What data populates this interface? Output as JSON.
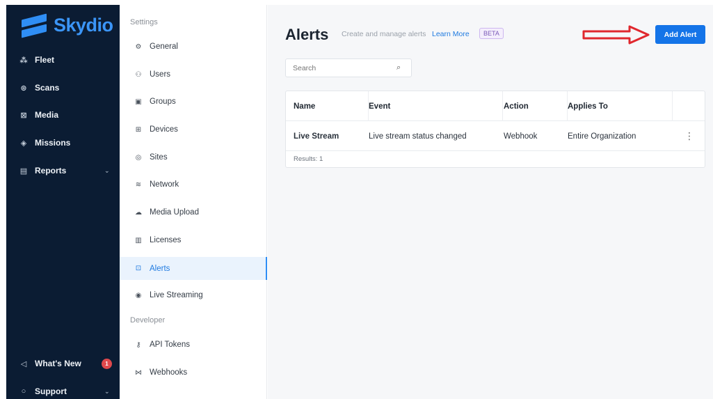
{
  "app": {
    "brand": "Skydio"
  },
  "sidebar": {
    "items": [
      {
        "label": "Fleet",
        "icon": "fleet-icon",
        "glyph": "⁂"
      },
      {
        "label": "Scans",
        "icon": "scans-icon",
        "glyph": "⊛"
      },
      {
        "label": "Media",
        "icon": "media-icon",
        "glyph": "⊠"
      },
      {
        "label": "Missions",
        "icon": "missions-icon",
        "glyph": "◈"
      },
      {
        "label": "Reports",
        "icon": "reports-icon",
        "glyph": "▤"
      }
    ],
    "whats_new": {
      "label": "What's New",
      "badge": "1"
    },
    "support": {
      "label": "Support"
    }
  },
  "settings": {
    "section_title": "Settings",
    "items": [
      {
        "label": "General",
        "glyph": "⚙"
      },
      {
        "label": "Users",
        "glyph": "⚇"
      },
      {
        "label": "Groups",
        "glyph": "▣"
      },
      {
        "label": "Devices",
        "glyph": "⊞"
      },
      {
        "label": "Sites",
        "glyph": "◎"
      },
      {
        "label": "Network",
        "glyph": "≋"
      },
      {
        "label": "Media Upload",
        "glyph": "☁"
      },
      {
        "label": "Licenses",
        "glyph": "▥"
      },
      {
        "label": "Alerts",
        "glyph": "⊡"
      },
      {
        "label": "Live Streaming",
        "glyph": "◉"
      }
    ],
    "developer_title": "Developer",
    "developer_items": [
      {
        "label": "API Tokens",
        "glyph": "⚷"
      },
      {
        "label": "Webhooks",
        "glyph": "⋈"
      }
    ],
    "active": "Alerts"
  },
  "main": {
    "title": "Alerts",
    "subtitle": "Create and manage alerts",
    "learn_more": "Learn More",
    "beta": "BETA",
    "add_alert": "Add Alert",
    "search_placeholder": "Search",
    "table": {
      "headers": [
        "Name",
        "Event",
        "Action",
        "Applies To"
      ],
      "rows": [
        {
          "name": "Live Stream",
          "event": "Live stream status changed",
          "action": "Webhook",
          "applies_to": "Entire Organization"
        }
      ],
      "results": "Results: 1"
    }
  },
  "colors": {
    "sidebar_bg": "#0b1c33",
    "accent": "#1474e8",
    "annotation_arrow": "#e0282e"
  }
}
